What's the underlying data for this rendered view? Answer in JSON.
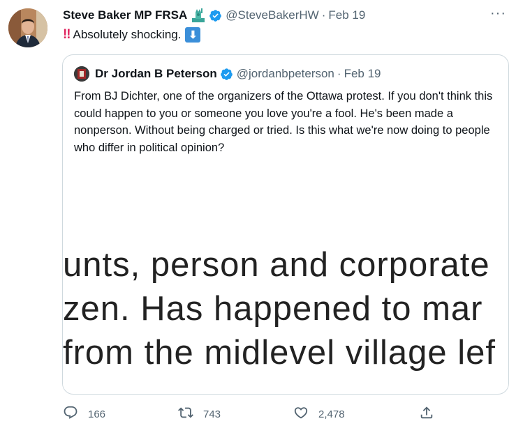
{
  "tweet": {
    "author_name": "Steve Baker MP FRSA",
    "handle": "@SteveBakerHW",
    "separator": "·",
    "date": "Feb 19",
    "more": "···",
    "text": "Absolutely shocking.",
    "emoji_left": "‼",
    "emoji_right": "⬇"
  },
  "quoted": {
    "author_name": "Dr Jordan B Peterson",
    "handle": "@jordanbpeterson",
    "separator": "·",
    "date": "Feb 19",
    "text": "From BJ Dichter, one of the organizers of the Ottawa protest. If you don't think this could happen to you or someone you love you're a fool. He's been made a nonperson. Without being charged or tried. Is this what we're now doing to people who differ in political opinion?",
    "image_lines": [
      "unts, person and corporate",
      "zen.  Has happened to mar",
      "from the midlevel village lef"
    ]
  },
  "actions": {
    "replies": "166",
    "retweets": "743",
    "likes": "2,478"
  },
  "icons": {
    "reply": "reply-icon",
    "retweet": "retweet-icon",
    "like": "heart-icon",
    "share": "share-icon",
    "verified": "verified-badge-icon",
    "flag": "statue-of-liberty-icon"
  },
  "colors": {
    "verified": "#1d9bf0",
    "secondary_text": "#536471",
    "border": "#cfd9de"
  }
}
